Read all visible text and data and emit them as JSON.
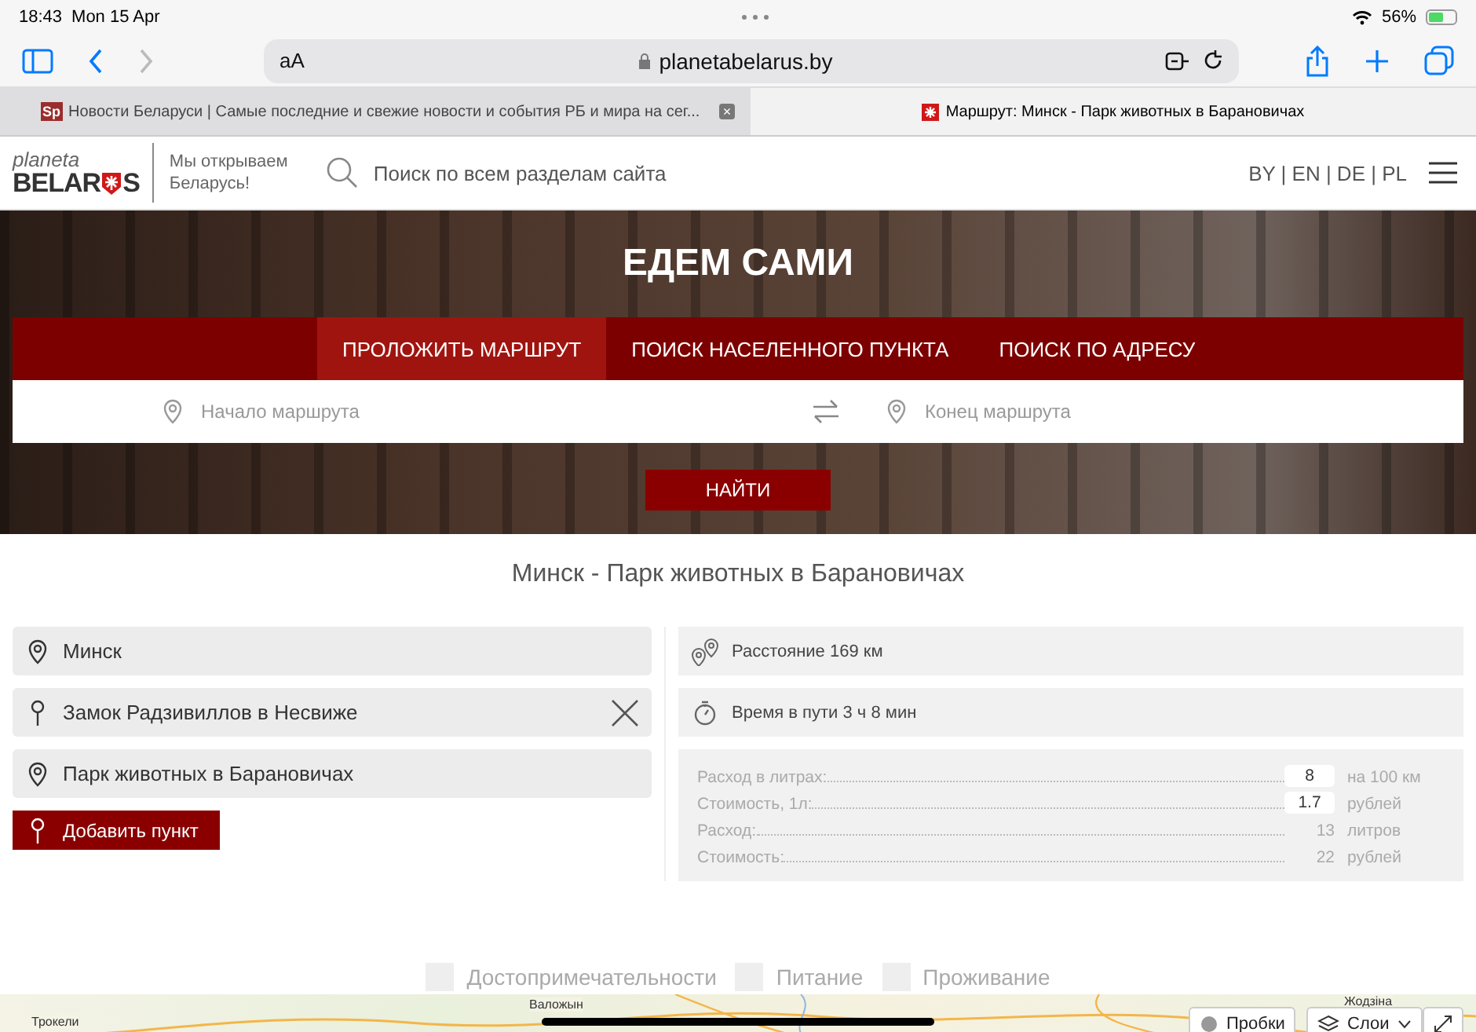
{
  "status_bar": {
    "time": "18:43",
    "date": "Mon 15 Apr",
    "battery": "56%"
  },
  "browser": {
    "text_size_button": "aA",
    "url": "planetabelarus.by",
    "tabs": [
      {
        "favicon": "Sp",
        "title": "Новости Беларуси | Самые последние и свежие новости и события РБ и мира на сег...",
        "close": "×",
        "selected": false
      },
      {
        "title": "Маршрут: Минск - Парк животных в Барановичах",
        "selected": true
      }
    ]
  },
  "site_header": {
    "logo_top": "planeta",
    "logo_left": "BELAR",
    "logo_right": "S",
    "tagline": "Мы открываем Беларусь!",
    "search": {
      "placeholder": "Поиск по всем разделам сайта"
    },
    "languages": "BY | EN | DE | PL"
  },
  "hero": {
    "title": "ЕДЕМ САМИ",
    "tabs": [
      {
        "label": "ПРОЛОЖИТЬ МАРШРУТ",
        "selected": true
      },
      {
        "label": "ПОИСК НАСЕЛЕННОГО ПУНКТА",
        "selected": false
      },
      {
        "label": "ПОИСК ПО АДРЕСУ",
        "selected": false
      }
    ],
    "from": {
      "placeholder": "Начало маршрута"
    },
    "to": {
      "placeholder": "Конец маршрута"
    },
    "find_button": "НАЙТИ"
  },
  "route": {
    "title": "Минск - Парк животных в Барановичах",
    "points": [
      {
        "kind": "start",
        "value": "Минск",
        "removable": false
      },
      {
        "kind": "via",
        "value": "Замок Радзивиллов в Несвиже",
        "removable": true
      },
      {
        "kind": "end",
        "value": "Парк животных в Барановичах",
        "removable": false
      }
    ],
    "add_button": "Добавить пункт",
    "stats": [
      {
        "kind": "distance",
        "text": "Расстояние 169 км"
      },
      {
        "kind": "time",
        "text": "Время в пути 3 ч 8 мин"
      }
    ],
    "fuel": [
      {
        "kind": "input",
        "label": "Расход в литрах:",
        "value": "8",
        "unit": "на 100 км"
      },
      {
        "kind": "input",
        "label": "Стоимость, 1л:",
        "value": "1.7",
        "unit": "рублей"
      },
      {
        "kind": "output",
        "label": "Расход:",
        "value": "13",
        "unit": "литров"
      },
      {
        "kind": "output",
        "label": "Стоимость:",
        "value": "22",
        "unit": "рублей"
      }
    ]
  },
  "filters": [
    {
      "label": "Достопримечательности",
      "checked": false
    },
    {
      "label": "Питание",
      "checked": false
    },
    {
      "label": "Проживание",
      "checked": false
    }
  ],
  "map": {
    "labels": [
      "Валожын",
      "Трокели",
      "Жодзіна"
    ],
    "traffic_button": "Пробки",
    "layers_button": "Слои"
  }
}
